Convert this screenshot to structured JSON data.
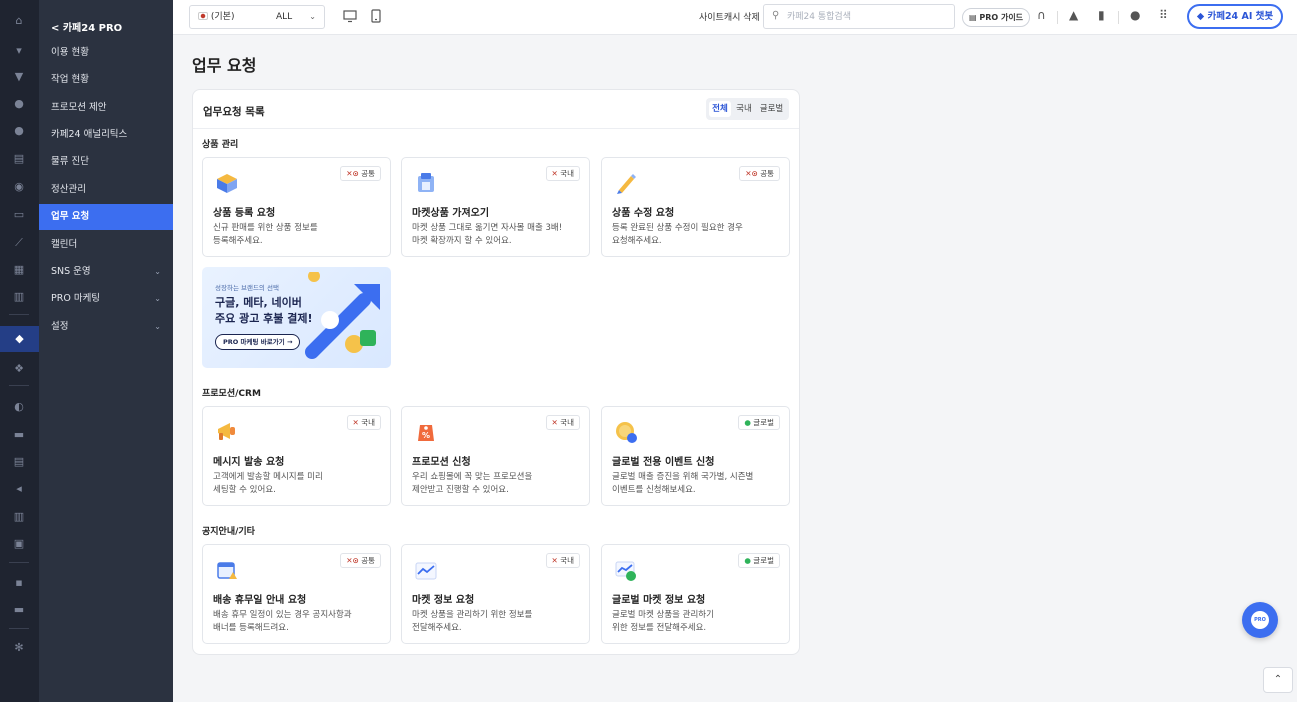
{
  "sidebar": {
    "header": "< 카페24 PRO",
    "items": [
      {
        "label": "이용 현황",
        "has_children": false
      },
      {
        "label": "작업 현황",
        "has_children": false
      },
      {
        "label": "프로모션 제안",
        "has_children": false
      },
      {
        "label": "카페24 애널리틱스",
        "has_children": false
      },
      {
        "label": "물류 진단",
        "has_children": false
      },
      {
        "label": "정산관리",
        "has_children": false
      },
      {
        "label": "업무 요청",
        "has_children": false,
        "active": true
      },
      {
        "label": "캘린더",
        "has_children": false
      },
      {
        "label": "SNS 운영",
        "has_children": true
      },
      {
        "label": "PRO 마케팅",
        "has_children": true
      },
      {
        "label": "설정",
        "has_children": true
      }
    ],
    "chevron": "⌄"
  },
  "topbar": {
    "language": "(기본)",
    "store": "ALL",
    "site_cache": "사이트캐시 삭제",
    "search_placeholder": "카페24 통합검색",
    "pro_guide": "PRO 가이드",
    "ai_chatbot": "카페24 AI 챗봇"
  },
  "page": {
    "title": "업무 요청"
  },
  "panel": {
    "title": "업무요청 목록",
    "filters": [
      {
        "label": "전체",
        "selected": true
      },
      {
        "label": "국내",
        "selected": false
      },
      {
        "label": "글로벌",
        "selected": false
      }
    ]
  },
  "sections": [
    {
      "title": "상품 관리",
      "cards": [
        {
          "title": "상품 등록 요청",
          "desc1": "신규 판매를 위한 상품 정보를",
          "desc2": "등록해주세요.",
          "tag": "공통",
          "tag_mark": "✕⊙",
          "icon": "box-icon"
        },
        {
          "title": "마켓상품 가져오기",
          "desc1": "마켓 상품 그대로 옮기면 자사몰 매출 3배!",
          "desc2": "마켓 확장까지 할 수 있어요.",
          "tag": "국내",
          "tag_mark": "✕",
          "icon": "market-import-icon"
        },
        {
          "title": "상품 수정 요청",
          "desc1": "등록 완료된 상품 수정이 필요한 경우",
          "desc2": "요청해주세요.",
          "tag": "공통",
          "tag_mark": "✕⊙",
          "icon": "pencil-icon"
        }
      ]
    },
    {
      "title": "프로모션/CRM",
      "cards": [
        {
          "title": "메시지 발송 요청",
          "desc1": "고객에게 발송할 메시지를 미리",
          "desc2": "세팅할 수 있어요.",
          "tag": "국내",
          "tag_mark": "✕",
          "icon": "megaphone-icon"
        },
        {
          "title": "프로모션 신청",
          "desc1": "우리 쇼핑몰에 꼭 맞는 프로모션을",
          "desc2": "제안받고 진행할 수 있어요.",
          "tag": "국내",
          "tag_mark": "✕",
          "icon": "percent-tag-icon"
        },
        {
          "title": "글로벌 전용 이벤트 신청",
          "desc1": "글로벌 매출 증진을 위해 국가별, 시즌별",
          "desc2": "이벤트를 신청해보세요.",
          "tag": "글로벌",
          "tag_mark": "●",
          "icon": "coin-percent-icon"
        }
      ]
    },
    {
      "title": "공지안내/기타",
      "cards": [
        {
          "title": "배송 휴무일 안내 요청",
          "desc1": "배송 휴무 일정이 있는 경우 공지사항과",
          "desc2": "배너를 등록해드려요.",
          "tag": "공통",
          "tag_mark": "✕⊙",
          "icon": "calendar-icon"
        },
        {
          "title": "마켓 정보 요청",
          "desc1": "마켓 상품을 관리하기 위한 정보를",
          "desc2": "전달해주세요.",
          "tag": "국내",
          "tag_mark": "✕",
          "icon": "chart-line-icon"
        },
        {
          "title": "글로벌 마켓 정보 요청",
          "desc1": "글로벌 마켓 상품을 관리하기",
          "desc2": "위한 정보를 전달해주세요.",
          "tag": "글로벌",
          "tag_mark": "●",
          "icon": "globe-chart-icon"
        }
      ]
    }
  ],
  "banner": {
    "subtitle": "성장하는 브랜드의 선택",
    "line1": "구글, 메타, 네이버",
    "line2": "주요 광고 후불 결제!",
    "button": "PRO 마케팅 바로가기 →"
  },
  "fab": {
    "label": "PRO"
  },
  "colors": {
    "accent": "#3c6ef0",
    "sidebar": "#2b3240",
    "rail": "#1f2430"
  }
}
